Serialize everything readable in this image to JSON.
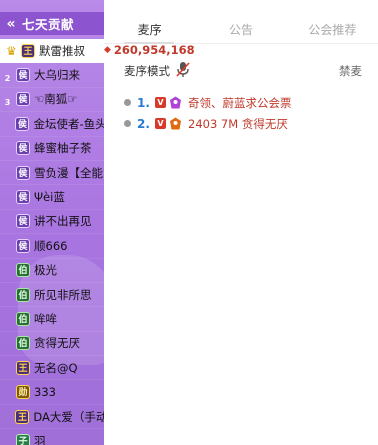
{
  "rank_panel": {
    "title": "七天贡献",
    "collapse_icon": "double-chevron-left-icon",
    "score": "260,954,168",
    "rows": [
      {
        "place": "1",
        "badge": "王",
        "name": "默雷推叔"
      },
      {
        "place": "2",
        "badge": "侯",
        "name": "大乌归来"
      },
      {
        "place": "3",
        "badge": "侯",
        "name": "☜南狐☞"
      },
      {
        "place": "",
        "badge": "侯",
        "name": "金坛使者-鱼头"
      },
      {
        "place": "",
        "badge": "侯",
        "name": "蜂蜜柚子茶"
      },
      {
        "place": "",
        "badge": "侯",
        "name": "雪负漫【全能"
      },
      {
        "place": "",
        "badge": "侯",
        "name": "Ψèi蓝"
      },
      {
        "place": "",
        "badge": "侯",
        "name": "讲不出再见"
      },
      {
        "place": "",
        "badge": "侯",
        "name": "顺666"
      },
      {
        "place": "",
        "badge": "伯",
        "name": "极光"
      },
      {
        "place": "",
        "badge": "伯",
        "name": "所见非所思"
      },
      {
        "place": "",
        "badge": "伯",
        "name": "哞哞"
      },
      {
        "place": "",
        "badge": "伯",
        "name": "贪得无厌"
      },
      {
        "place": "",
        "badge": "王",
        "name": "无名@Q"
      },
      {
        "place": "",
        "badge": "勋",
        "name": "333"
      },
      {
        "place": "",
        "badge": "王",
        "name": "DA大爱（手动"
      },
      {
        "place": "",
        "badge": "子",
        "name": "羽"
      }
    ]
  },
  "tabs": [
    {
      "label": "麦序",
      "active": true
    },
    {
      "label": "公告",
      "active": false
    },
    {
      "label": "公会推荐",
      "active": false
    }
  ],
  "mic_mode": {
    "label": "麦序模式",
    "icon": "mic-muted-icon",
    "ban_label": "禁麦"
  },
  "queue": [
    {
      "num": "1.",
      "vip": "V",
      "name": "奇领、蔚蓝求公会票"
    },
    {
      "num": "2.",
      "vip": "V",
      "name": "2403 7M 贪得无厌"
    }
  ]
}
